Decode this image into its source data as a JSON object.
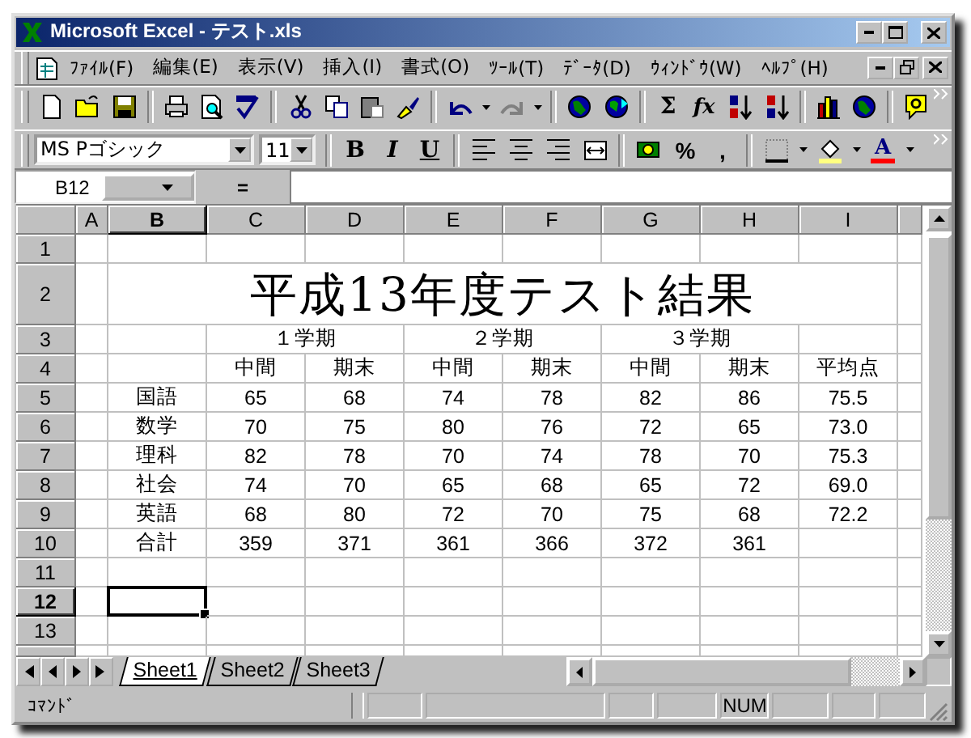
{
  "window": {
    "title": "Microsoft Excel - テスト.xls"
  },
  "menu": {
    "items": [
      "ﾌｧｲﾙ(F)",
      "編集(E)",
      "表示(V)",
      "挿入(I)",
      "書式(O)",
      "ﾂｰﾙ(T)",
      "ﾃﾞｰﾀ(D)",
      "ｳｨﾝﾄﾞｳ(W)",
      "ﾍﾙﾌﾟ(H)"
    ]
  },
  "standard_toolbar": {
    "text_buttons": [
      "Σ",
      "fx"
    ]
  },
  "formatting_toolbar": {
    "font": "MS Pゴシック",
    "size": "11",
    "style_buttons": [
      "B",
      "I",
      "U"
    ],
    "number_buttons": [
      "%",
      ","
    ],
    "font_color_button": "A"
  },
  "formula_bar": {
    "name_box": "B12",
    "equals": "="
  },
  "sheet": {
    "columns": [
      {
        "label": "A",
        "selected": false
      },
      {
        "label": "B",
        "selected": true
      },
      {
        "label": "C",
        "selected": false
      },
      {
        "label": "D",
        "selected": false
      },
      {
        "label": "E",
        "selected": false
      },
      {
        "label": "F",
        "selected": false
      },
      {
        "label": "G",
        "selected": false
      },
      {
        "label": "H",
        "selected": false
      },
      {
        "label": "I",
        "selected": false
      }
    ],
    "rows": [
      {
        "label": "1",
        "selected": false
      },
      {
        "label": "2",
        "selected": false,
        "cells": [
          null,
          {
            "kind": "title",
            "text": "平成13年度テスト結果"
          }
        ]
      },
      {
        "label": "3",
        "selected": false,
        "cells": [
          null,
          null,
          {
            "kind": "group",
            "text": "１学期"
          },
          {
            "kind": "group",
            "text": "２学期"
          },
          {
            "kind": "group",
            "text": "３学期"
          }
        ]
      },
      {
        "label": "4",
        "selected": false,
        "cells": [
          null,
          null,
          {
            "text": "中間"
          },
          {
            "text": "期末"
          },
          {
            "text": "中間"
          },
          {
            "text": "期末"
          },
          {
            "text": "中間"
          },
          {
            "text": "期末"
          },
          {
            "text": "平均点"
          }
        ]
      },
      {
        "label": "5",
        "selected": false,
        "cells": [
          null,
          {
            "text": "国語"
          },
          {
            "text": "65"
          },
          {
            "text": "68"
          },
          {
            "text": "74"
          },
          {
            "text": "78"
          },
          {
            "text": "82"
          },
          {
            "text": "86"
          },
          {
            "text": "75.5"
          }
        ]
      },
      {
        "label": "6",
        "selected": false,
        "cells": [
          null,
          {
            "text": "数学"
          },
          {
            "text": "70"
          },
          {
            "text": "75"
          },
          {
            "text": "80"
          },
          {
            "text": "76"
          },
          {
            "text": "72"
          },
          {
            "text": "65"
          },
          {
            "text": "73.0"
          }
        ]
      },
      {
        "label": "7",
        "selected": false,
        "cells": [
          null,
          {
            "text": "理科"
          },
          {
            "text": "82"
          },
          {
            "text": "78"
          },
          {
            "text": "70"
          },
          {
            "text": "74"
          },
          {
            "text": "78"
          },
          {
            "text": "70"
          },
          {
            "text": "75.3"
          }
        ]
      },
      {
        "label": "8",
        "selected": false,
        "cells": [
          null,
          {
            "text": "社会"
          },
          {
            "text": "74"
          },
          {
            "text": "70"
          },
          {
            "text": "65"
          },
          {
            "text": "68"
          },
          {
            "text": "65"
          },
          {
            "text": "72"
          },
          {
            "text": "69.0"
          }
        ]
      },
      {
        "label": "9",
        "selected": false,
        "cells": [
          null,
          {
            "text": "英語"
          },
          {
            "text": "68"
          },
          {
            "text": "80"
          },
          {
            "text": "72"
          },
          {
            "text": "70"
          },
          {
            "text": "75"
          },
          {
            "text": "68"
          },
          {
            "text": "72.2"
          }
        ]
      },
      {
        "label": "10",
        "selected": false,
        "cells": [
          null,
          {
            "text": "合計"
          },
          {
            "text": "359"
          },
          {
            "text": "371"
          },
          {
            "text": "361"
          },
          {
            "text": "366"
          },
          {
            "text": "372"
          },
          {
            "text": "361"
          }
        ]
      },
      {
        "label": "11",
        "selected": false
      },
      {
        "label": "12",
        "selected": true
      },
      {
        "label": "13",
        "selected": false
      }
    ]
  },
  "sheet_tabs": [
    {
      "label": "Sheet1",
      "selected": true
    },
    {
      "label": "Sheet2",
      "selected": false
    },
    {
      "label": "Sheet3",
      "selected": false
    }
  ],
  "status_bar": {
    "mode": "ｺﾏﾝﾄﾞ",
    "indicators": [
      "NUM"
    ]
  }
}
